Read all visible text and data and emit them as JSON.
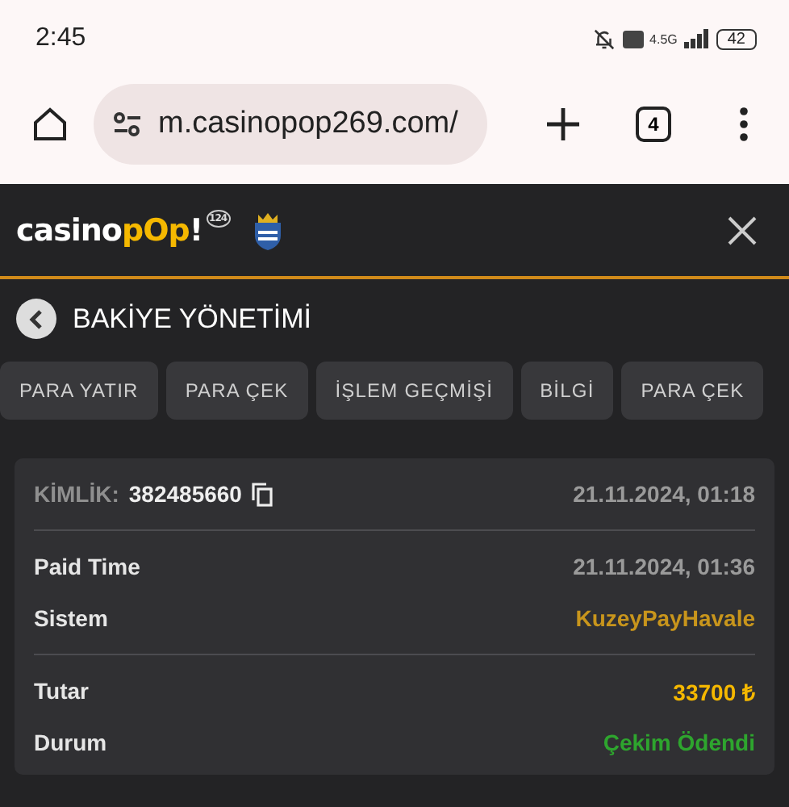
{
  "status_bar": {
    "time": "2:45",
    "network": "4.5G",
    "battery": "42"
  },
  "browser": {
    "url": "m.casinopop269.com/",
    "tab_count": "4"
  },
  "header": {
    "logo": [
      {
        "text": "casino",
        "accent": false
      },
      {
        "text": "pOp",
        "accent": true
      },
      {
        "text": "!",
        "accent": false
      }
    ],
    "logo_badge": "124"
  },
  "page_title": "BAKİYE YÖNETİMİ",
  "tabs": [
    {
      "label": "PARA YATIR",
      "selected": false
    },
    {
      "label": "PARA ÇEK",
      "selected": false
    },
    {
      "label": "İŞLEM GEÇMİŞİ",
      "selected": false
    },
    {
      "label": "BİLGİ",
      "selected": false
    },
    {
      "label": "PARA ÇEK",
      "selected": false
    }
  ],
  "card": {
    "id_label": "KİMLİK:",
    "id_value": "382485660",
    "date": "21.11.2024, 01:18",
    "groups": [
      [
        {
          "label": "Paid Time",
          "value": "21.11.2024, 01:36",
          "color": "#9a9a9a"
        },
        {
          "label": "Sistem",
          "value": "KuzeyPayHavale",
          "color": "#c8951c"
        }
      ],
      [
        {
          "label": "Tutar",
          "value": "33700 ₺",
          "color": "#f5b800"
        },
        {
          "label": "Durum",
          "value": "Çekim Ödendi",
          "color": "#2ea52e"
        }
      ]
    ]
  }
}
